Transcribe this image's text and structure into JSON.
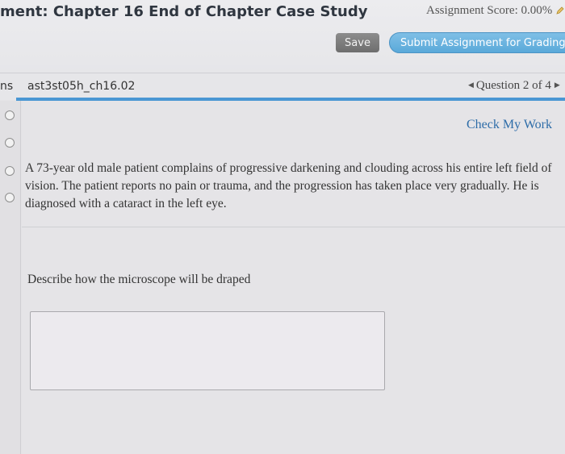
{
  "header": {
    "title": "ment: Chapter 16 End of Chapter Case Study",
    "score_label": "Assignment Score: 0.00%",
    "save_label": "Save",
    "submit_label": "Submit Assignment for Grading"
  },
  "question_bar": {
    "left_fragment": "ns",
    "question_id": "ast3st05h_ch16.02",
    "nav_label": "Question 2 of 4"
  },
  "sidebar": {
    "radio_count": 4
  },
  "main": {
    "check_work_label": "Check My Work",
    "scenario": "A 73-year old male patient complains of progressive darkening and clouding across his entire left field of vision. The patient reports no pain or trauma, and the progression has taken place very gradually. He is diagnosed with a cataract in the left eye.",
    "prompt": "Describe how the microscope will be draped",
    "answer_value": ""
  },
  "colors": {
    "accent_blue": "#4a97d3",
    "submit_button": "#6ab4e0",
    "link": "#2d6ca8"
  }
}
